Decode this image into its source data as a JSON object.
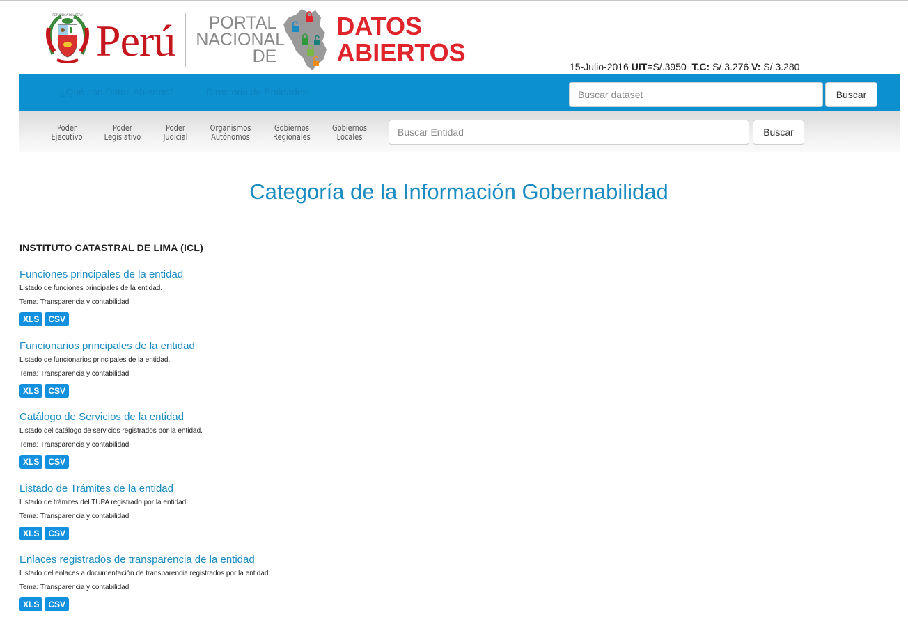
{
  "header": {
    "country": "Perú",
    "portal_line1": "PORTAL",
    "portal_line2": "NACIONAL",
    "portal_line3": "DE",
    "datos_line1": "DATOS",
    "datos_line2": "ABIERTOS",
    "econ": {
      "date": "15-Julio-2016",
      "uit_label": "UIT",
      "uit_value": "=S/.3950",
      "tc_label": "T.C:",
      "tc_value": "S/.3.276",
      "v_label": "V:",
      "v_value": "S/.3.280"
    }
  },
  "topnav": {
    "link1": "¿Qué son Datos Abiertos?",
    "link2": "Directorio de Entidades",
    "search_placeholder": "Buscar dataset",
    "search_button": "Buscar"
  },
  "subnav": {
    "items": [
      {
        "line1": "Poder",
        "line2": "Ejecutivo"
      },
      {
        "line1": "Poder",
        "line2": "Legislativo"
      },
      {
        "line1": "Poder",
        "line2": "Judicial"
      },
      {
        "line1": "Organismos",
        "line2": "Autónomos"
      },
      {
        "line1": "Gobiernos",
        "line2": "Regionales"
      },
      {
        "line1": "Gobiernos",
        "line2": "Locales"
      }
    ],
    "search_placeholder": "Buscar Entidad",
    "search_button": "Buscar"
  },
  "page": {
    "title": "Categoría de la Información Gobernabilidad",
    "entity": "INSTITUTO CATASTRAL DE LIMA  (ICL)"
  },
  "datasets": [
    {
      "title": "Funciones principales de la entidad",
      "description": "Listado de funciones principales de la entidad.",
      "tema": "Tema: Transparencia y contabilidad",
      "formats": [
        "XLS",
        "CSV"
      ]
    },
    {
      "title": "Funcionarios principales de la entidad",
      "description": "Listado de funcionarios principales de la entidad.",
      "tema": "Tema: Transparencia y contabilidad",
      "formats": [
        "XLS",
        "CSV"
      ]
    },
    {
      "title": "Catálogo de Servicios de la entidad",
      "description": "Listado del catálogo de servicios registrados por la entidad.",
      "tema": "Tema: Transparencia y contabilidad",
      "formats": [
        "XLS",
        "CSV"
      ]
    },
    {
      "title": "Listado de Trámites de la entidad",
      "description": "Listado de trámites del TUPA registrado por la entidad.",
      "tema": "Tema: Transparencia y contabilidad",
      "formats": [
        "XLS",
        "CSV"
      ]
    },
    {
      "title": "Enlaces registrados de transparencia de la entidad",
      "description": "Listado del enlaces a documentación de transparencia registrados por la entidad.",
      "tema": "Tema: Transparencia y contabilidad",
      "formats": [
        "XLS",
        "CSV"
      ]
    }
  ],
  "colors": {
    "blue_bar": "#0d90cf",
    "link_blue": "#1a8cc2",
    "badge_blue": "#1491de",
    "brand_red": "#c4161c"
  }
}
